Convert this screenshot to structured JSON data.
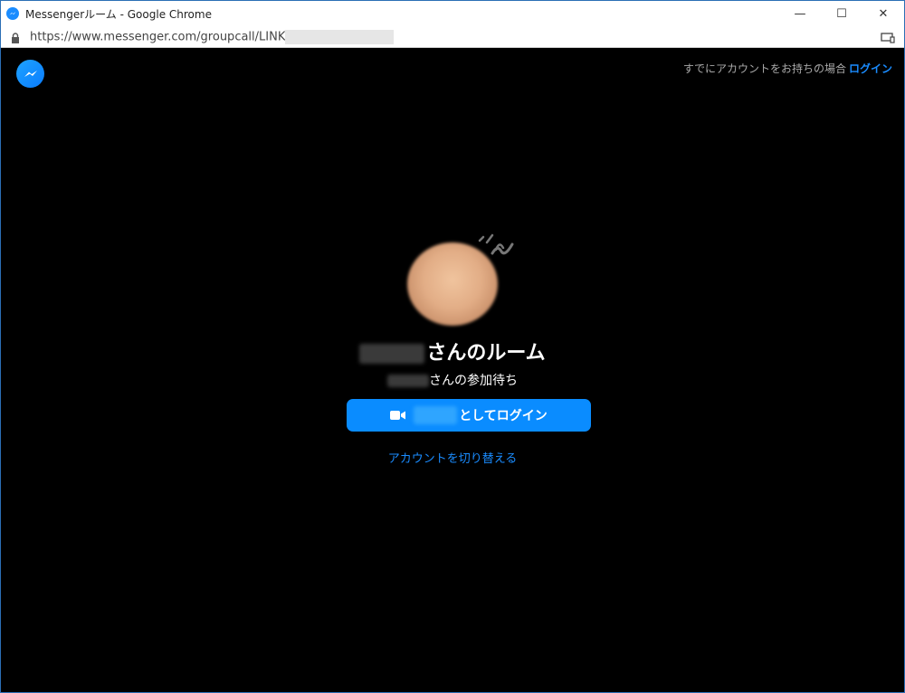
{
  "window": {
    "title": "Messengerルーム - Google Chrome",
    "controls": {
      "minimize": "—",
      "maximize": "☐",
      "close": "✕"
    }
  },
  "browser": {
    "url_visible": "https://www.messenger.com/groupcall/LINK",
    "icons": [
      "lock-icon",
      "cast-icon"
    ]
  },
  "header": {
    "prompt": "すでにアカウントをお持ちの場合",
    "login_link": "ログイン"
  },
  "room": {
    "title_suffix": "さんのルーム",
    "waiting_suffix": "さんの参加待ち",
    "login_button_suffix": "としてログイン",
    "switch_account": "アカウントを切り替える"
  },
  "colors": {
    "accent": "#0a8cff",
    "background": "#000000",
    "text": "#ffffff"
  }
}
